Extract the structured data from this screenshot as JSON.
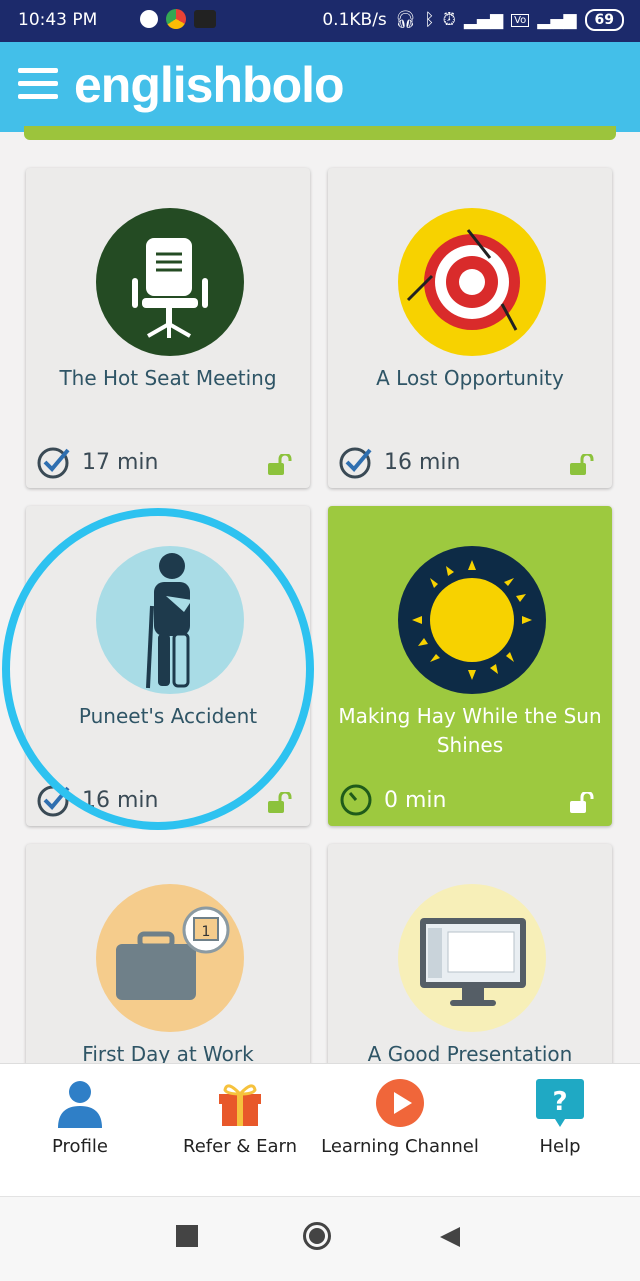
{
  "status_bar": {
    "time": "10:43 PM",
    "speed": "0.1KB/s",
    "battery": "69",
    "icons": [
      "messenger-icon",
      "chrome-icon",
      "app-icon",
      "headphones-icon",
      "bluetooth-icon",
      "alarm-icon",
      "signal-icon",
      "volte-icon",
      "signal-4g-icon",
      "battery-icon"
    ]
  },
  "app_bar": {
    "logo": "englishbolo",
    "menu_icon": "hamburger-menu-icon"
  },
  "lessons": [
    {
      "title": "The Hot Seat Meeting",
      "duration": "17 min",
      "icon": "office-chair-icon",
      "status": "completed",
      "locked": false,
      "bg": "#244b23"
    },
    {
      "title": "A Lost Opportunity",
      "duration": "16 min",
      "icon": "target-darts-icon",
      "status": "completed",
      "locked": false,
      "bg": "#f7d200"
    },
    {
      "title": "Puneet's Accident",
      "duration": "16 min",
      "icon": "injured-person-icon",
      "status": "completed",
      "locked": false,
      "bg": "#a9dce6"
    },
    {
      "title": "Making Hay While the Sun Shines",
      "duration": "0 min",
      "icon": "sun-icon",
      "status": "in-progress",
      "locked": false,
      "bg": "#0d2b46"
    },
    {
      "title": "First Day at Work",
      "duration": "",
      "icon": "briefcase-calendar-icon",
      "status": "",
      "locked": false,
      "bg": "#f5cc8c"
    },
    {
      "title": "A Good Presentation",
      "duration": "",
      "icon": "monitor-presentation-icon",
      "status": "",
      "locked": false,
      "bg": "#f7efb8"
    }
  ],
  "bottom_nav": [
    {
      "label": "Profile",
      "icon": "profile-icon"
    },
    {
      "label": "Refer & Earn",
      "icon": "gift-icon"
    },
    {
      "label": "Learning Channel",
      "icon": "play-icon"
    },
    {
      "label": "Help",
      "icon": "help-icon"
    }
  ],
  "colors": {
    "status_bar": "#1c2a6b",
    "app_bar": "#43bfe9",
    "accent_green": "#9dc93f",
    "highlight_ring": "#2dc2f0"
  }
}
